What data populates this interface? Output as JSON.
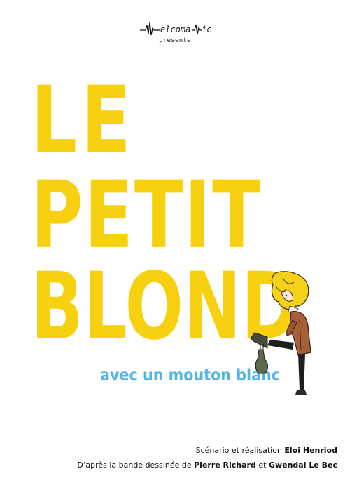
{
  "producer": {
    "logo_text": "Melcomanic",
    "presents": "présente"
  },
  "title": {
    "line1": "LE",
    "line2": "PETIT",
    "line3": "BLOND"
  },
  "subtitle": "avec un mouton blanc",
  "credits": {
    "direction_label": "Scénario et réalisation",
    "director": "Eloi Henriod",
    "adaptation_label": "D’après la bande dessinée de",
    "author1": "Pierre Richard",
    "connector": "et",
    "author2": "Gwendal Le Bec"
  },
  "colors": {
    "title": "#f7d00f",
    "subtitle": "#4fb6e6",
    "text": "#111111",
    "background": "#ffffff"
  },
  "icons": {
    "logo": "melcomanic-waveform-logo",
    "illustration": "blond-boy-kicking-illustration"
  }
}
